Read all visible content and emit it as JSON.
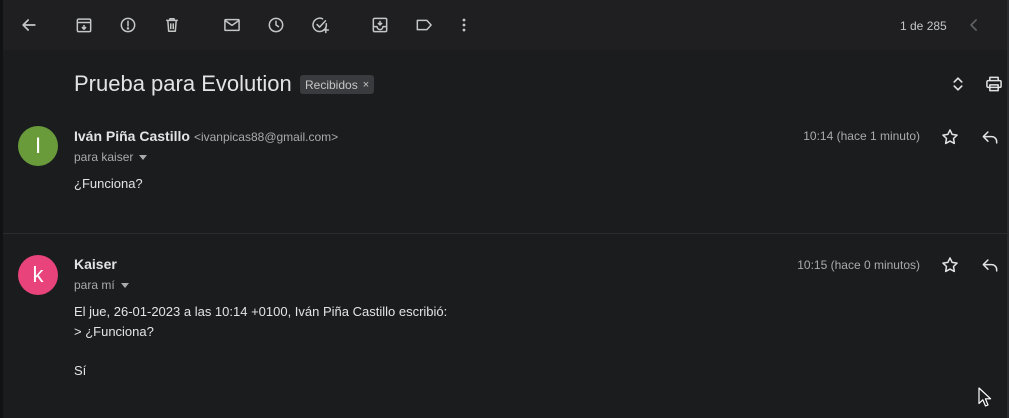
{
  "toolbar": {
    "items": [
      {
        "name": "back-button",
        "icon": "arrow-left-icon"
      },
      {
        "name": "archive-button",
        "icon": "archive-icon"
      },
      {
        "name": "report-spam-button",
        "icon": "report-icon"
      },
      {
        "name": "delete-button",
        "icon": "trash-icon"
      },
      {
        "name": "mark-unread-button",
        "icon": "mail-icon"
      },
      {
        "name": "snooze-button",
        "icon": "clock-icon"
      },
      {
        "name": "add-task-button",
        "icon": "add-task-icon"
      },
      {
        "name": "move-to-button",
        "icon": "move-to-inbox-icon"
      },
      {
        "name": "labels-button",
        "icon": "label-icon"
      },
      {
        "name": "more-button",
        "icon": "more-vert-icon"
      }
    ],
    "counter": "1 de 285",
    "prev_icon": "chevron-left-icon"
  },
  "thread": {
    "subject": "Prueba para Evolution",
    "label": "Recibidos",
    "label_remove": "×",
    "expand_icon": "unfold-more-icon",
    "print_icon": "print-icon"
  },
  "messages": [
    {
      "avatar_letter": "I",
      "avatar_color": "#6a9b3a",
      "sender": "Iván Piña Castillo",
      "email": "<ivanpicas88@gmail.com>",
      "recipients": "para kaiser",
      "time": "10:14 (hace 1 minuto)",
      "body": [
        "¿Funciona?"
      ]
    },
    {
      "avatar_letter": "k",
      "avatar_color": "#e8437a",
      "sender": "Kaiser",
      "email": "",
      "recipients": "para mí",
      "time": "10:15 (hace 0 minutos)",
      "body": [
        "El jue, 26-01-2023 a las 10:14 +0100, Iván Piña Castillo escribió:",
        "> ¿Funciona?",
        "Sí"
      ]
    }
  ],
  "colors": {
    "background": "#1b1c1e",
    "toolbar": "#1f1f21",
    "text": "#e3e3e3",
    "muted": "#a8abad"
  }
}
